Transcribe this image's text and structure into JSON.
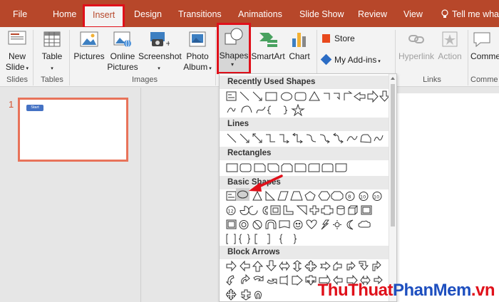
{
  "tabs": [
    {
      "id": "file",
      "label": "File"
    },
    {
      "id": "home",
      "label": "Home"
    },
    {
      "id": "insert",
      "label": "Insert",
      "active": true
    },
    {
      "id": "design",
      "label": "Design"
    },
    {
      "id": "transitions",
      "label": "Transitions"
    },
    {
      "id": "animations",
      "label": "Animations"
    },
    {
      "id": "slideshow",
      "label": "Slide Show"
    },
    {
      "id": "review",
      "label": "Review"
    },
    {
      "id": "view",
      "label": "View"
    }
  ],
  "tell_me": "Tell me what",
  "ribbon": {
    "new_slide_line1": "New",
    "new_slide_line2": "Slide",
    "table": "Table",
    "pictures": "Pictures",
    "online_line1": "Online",
    "online_line2": "Pictures",
    "screenshot": "Screenshot",
    "photo_line1": "Photo",
    "photo_line2": "Album",
    "shapes": "Shapes",
    "smartart": "SmartArt",
    "chart": "Chart",
    "store": "Store",
    "myaddins": "My Add-ins",
    "hyperlink": "Hyperlink",
    "action": "Action",
    "comment": "Comme",
    "groups": {
      "slides": "Slides",
      "tables": "Tables",
      "images": "Images",
      "links": "Links",
      "comments": "Comme"
    }
  },
  "slide": {
    "number": "1",
    "start_label": "Start"
  },
  "dropdown": {
    "sections": {
      "recent": "Recently Used Shapes",
      "lines": "Lines",
      "rectangles": "Rectangles",
      "basic": "Basic Shapes",
      "block": "Block Arrows"
    }
  },
  "watermark": {
    "part1": "ThuThuat",
    "part2": "PhanMem",
    "part3": ".vn"
  },
  "colors": {
    "accent": "#b7472a",
    "highlight": "#e0101a"
  }
}
